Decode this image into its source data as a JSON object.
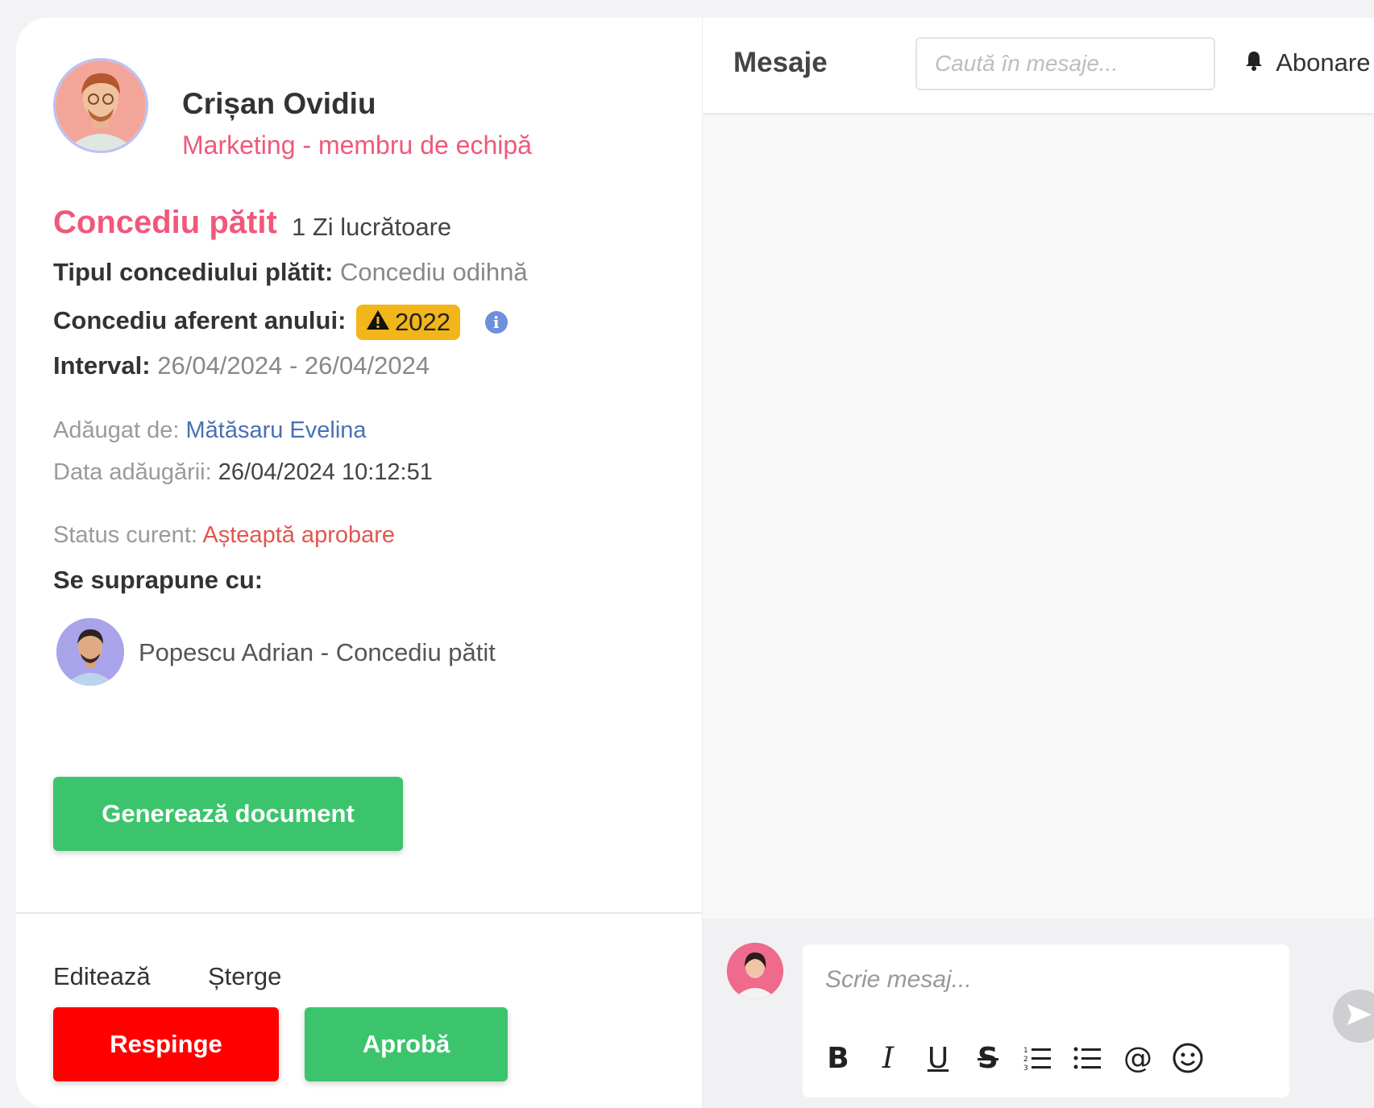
{
  "employee": {
    "name": "Crișan Ovidiu",
    "role": "Marketing - membru de echipă"
  },
  "leave": {
    "title": "Concediu pătit",
    "days": "1 Zi lucrătoare",
    "type_label": "Tipul concediului plătit:",
    "type_value": "Concediu odihnă",
    "year_label": "Concediu aferent anului:",
    "year_value": "2022",
    "interval_label": "Interval:",
    "interval_value": "26/04/2024 - 26/04/2024"
  },
  "meta": {
    "added_by_label": "Adăugat de:",
    "added_by_value": "Mătăsaru Evelina",
    "added_date_label": "Data adăugării:",
    "added_date_value": "26/04/2024 10:12:51",
    "status_label": "Status curent:",
    "status_value": "Așteaptă aprobare"
  },
  "overlap": {
    "title": "Se suprapune cu:",
    "items": [
      {
        "text": "Popescu Adrian - Concediu pătit"
      }
    ]
  },
  "actions": {
    "generate": "Generează document",
    "edit": "Editează",
    "delete": "Șterge",
    "reject": "Respinge",
    "approve": "Aprobă"
  },
  "messages": {
    "title": "Mesaje",
    "search_placeholder": "Caută în mesaje...",
    "subscribe": "Abonare",
    "compose_placeholder": "Scrie mesaj..."
  },
  "colors": {
    "accent_pink": "#f0587a",
    "green": "#3cc46d",
    "red": "#ff0000",
    "badge_yellow": "#f2b51a",
    "link_blue": "#4a6fb5"
  },
  "icons": [
    "warning-icon",
    "info-icon",
    "bell-icon",
    "bold-icon",
    "italic-icon",
    "underline-icon",
    "strikethrough-icon",
    "ordered-list-icon",
    "bullet-list-icon",
    "mention-icon",
    "emoji-icon",
    "send-icon"
  ]
}
